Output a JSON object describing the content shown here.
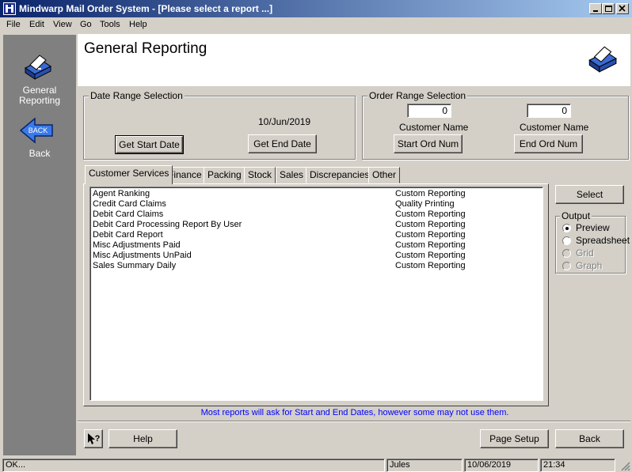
{
  "window": {
    "title": "Mindwarp Mail Order System - [Please select a report ...]"
  },
  "menu": [
    "File",
    "Edit",
    "View",
    "Go",
    "Tools",
    "Help"
  ],
  "sidebar": {
    "items": [
      {
        "label_line1": "General",
        "label_line2": "Reporting",
        "icon": "printer-icon"
      },
      {
        "label": "Back",
        "icon": "back-arrow-icon",
        "icon_text": "BACK"
      }
    ]
  },
  "header": {
    "title": "General Reporting",
    "icon": "printer-icon"
  },
  "date_range": {
    "label": "Date Range Selection",
    "end_date": "10/Jun/2019",
    "get_start_label": "Get Start Date",
    "get_end_label": "Get End Date"
  },
  "order_range": {
    "label": "Order Range Selection",
    "start_value": "0",
    "end_value": "0",
    "start_customer_label": "Customer Name",
    "end_customer_label": "Customer Name",
    "start_button": "Start Ord Num",
    "end_button": "End Ord Num"
  },
  "tabs": [
    "Customer Services",
    "Finance",
    "Packing",
    "Stock",
    "Sales",
    "Discrepancies",
    "Other"
  ],
  "reports": [
    {
      "name": "Agent Ranking",
      "category": "Custom Reporting"
    },
    {
      "name": "Credit Card Claims",
      "category": "Quality Printing"
    },
    {
      "name": "Debit Card Claims",
      "category": "Custom Reporting"
    },
    {
      "name": "Debit Card Processing Report By User",
      "category": "Custom Reporting"
    },
    {
      "name": "Debit Card Report",
      "category": "Custom Reporting"
    },
    {
      "name": "Misc Adjustments Paid",
      "category": "Custom Reporting"
    },
    {
      "name": "Misc Adjustments UnPaid",
      "category": "Custom Reporting"
    },
    {
      "name": "Sales Summary Daily",
      "category": "Custom Reporting"
    }
  ],
  "select_button": "Select",
  "output": {
    "label": "Output",
    "options": [
      {
        "label": "Preview",
        "checked": true,
        "enabled": true
      },
      {
        "label": "Spreadsheet",
        "checked": false,
        "enabled": true
      },
      {
        "label": "Grid",
        "checked": false,
        "enabled": false
      },
      {
        "label": "Graph",
        "checked": false,
        "enabled": false
      }
    ]
  },
  "note": "Most reports will ask for Start and End Dates, however some may not use them.",
  "bottom": {
    "help_label": "Help",
    "page_setup_label": "Page Setup",
    "back_label": "Back"
  },
  "status": {
    "message": "OK...",
    "user": "Jules",
    "date": "10/06/2019",
    "time": "21:34"
  },
  "colors": {
    "title_bar_start": "#0a246a",
    "title_bar_end": "#a6caf0",
    "face": "#d4d0c8",
    "sidebar": "#808080",
    "note_text": "#0000ff"
  }
}
